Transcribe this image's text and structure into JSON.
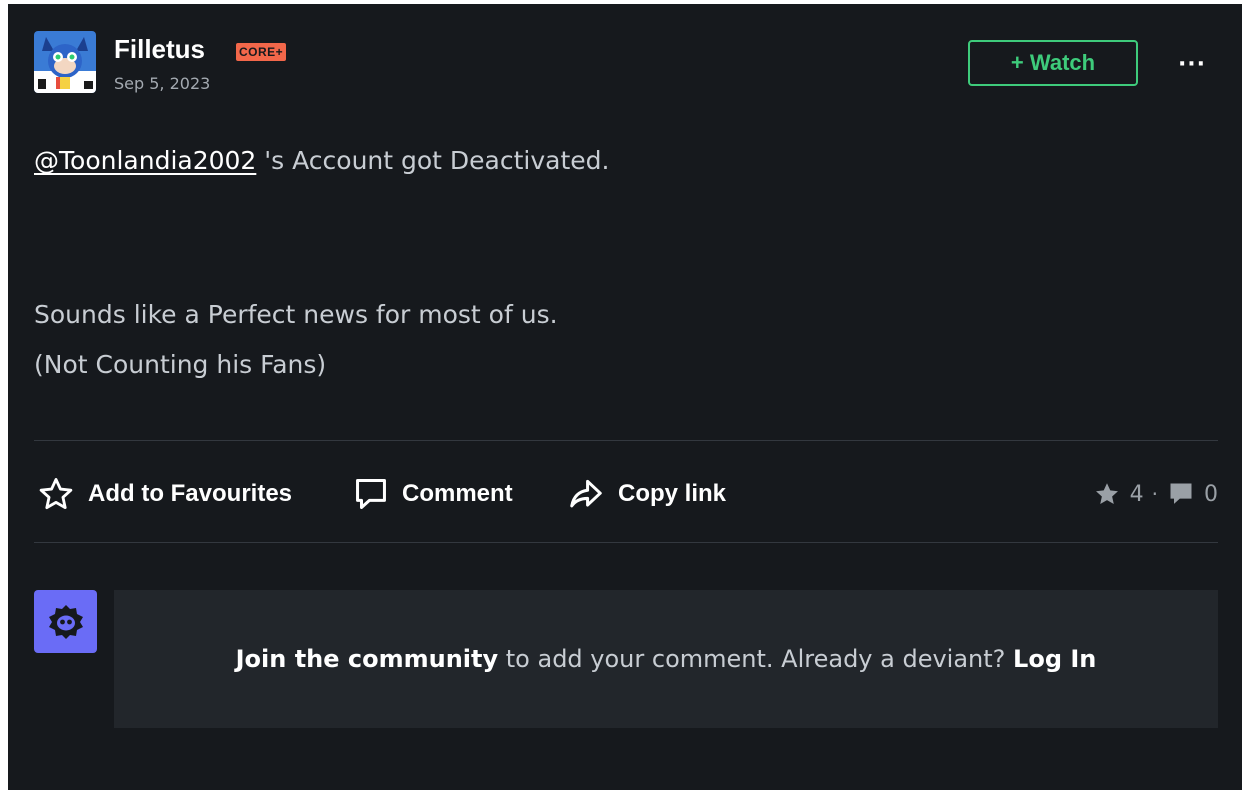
{
  "post": {
    "author": "Filletus",
    "badge": "CORE+",
    "date": "Sep 5, 2023",
    "watch_label": "+ Watch",
    "more_label": "···",
    "mention": "@Toonlandia2002",
    "line1_rest": " 's Account got Deactivated.",
    "line2": "Sounds like a Perfect news for most of us.",
    "line3": "(Not Counting his Fans)"
  },
  "actions": {
    "favourite_label": "Add to Favourites",
    "comment_label": "Comment",
    "copy_label": "Copy link"
  },
  "stats": {
    "favourites": "4",
    "separator": "·",
    "comments": "0"
  },
  "join": {
    "join_link": "Join the community",
    "middle": " to add your comment. Already a deviant? ",
    "login_link": "Log In"
  },
  "icons": {
    "avatar": "cartoon-cat-avatar",
    "guest": "deviant-guest-icon",
    "favourite": "star-outline-icon",
    "comment": "speech-bubble-icon",
    "copy": "share-arrow-icon",
    "stat_fav": "star-filled-icon",
    "stat_comment": "comment-filled-icon"
  },
  "colors": {
    "background": "#16191d",
    "accent_green": "#3ecb7b",
    "badge": "#f2674a",
    "guest_avatar": "#6a6cf6"
  }
}
